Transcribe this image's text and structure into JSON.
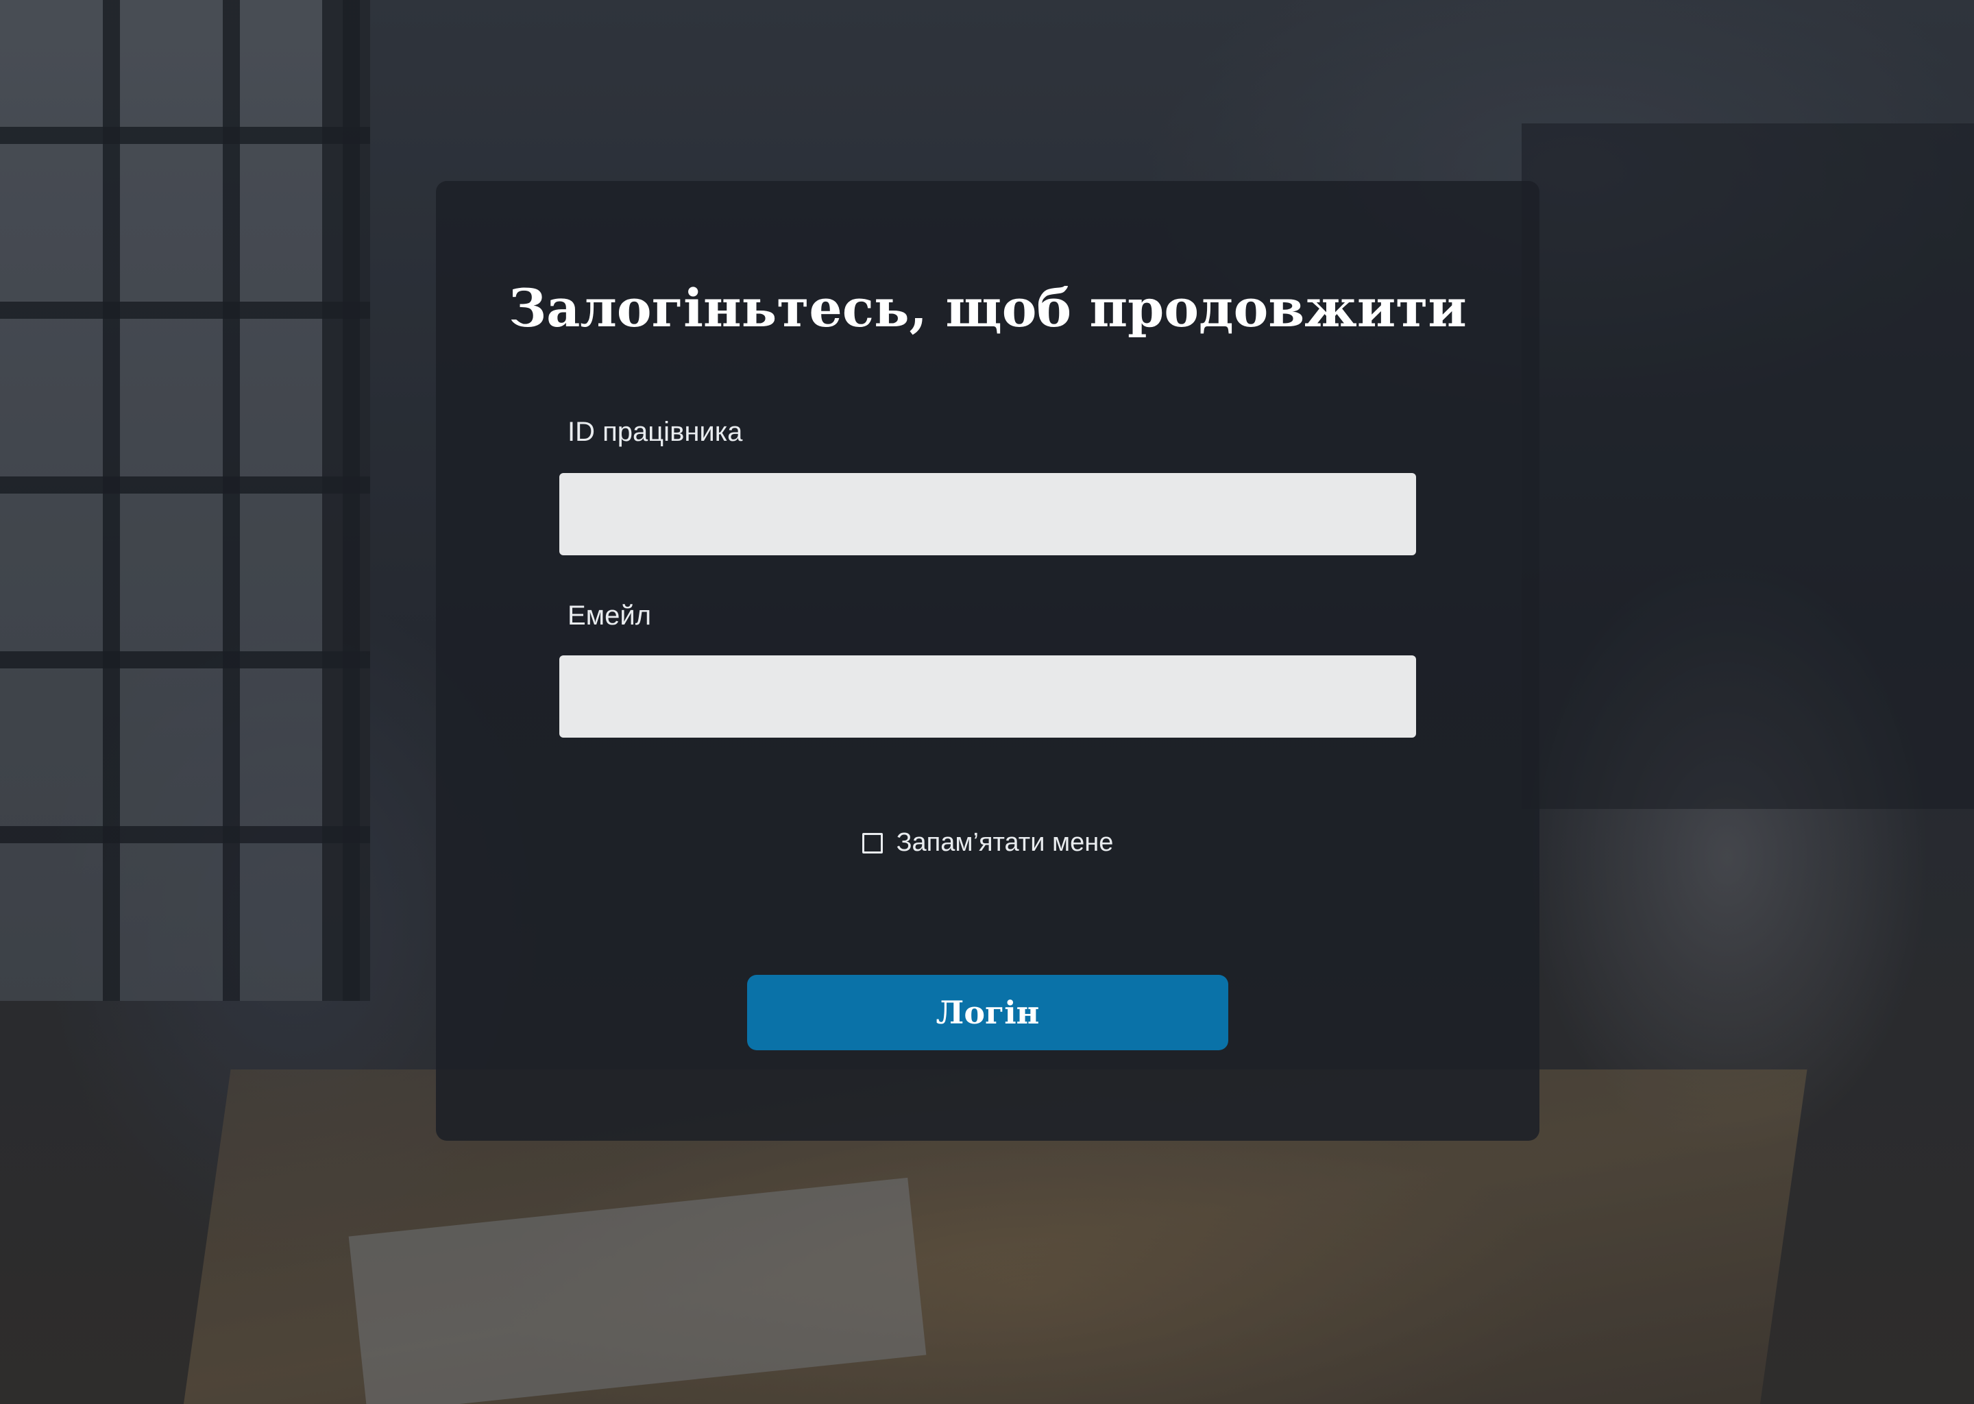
{
  "login": {
    "title": "Залогіньтесь, щоб продовжити",
    "employee_id": {
      "label": "ID працівника",
      "value": "",
      "placeholder": ""
    },
    "email": {
      "label": "Емейл",
      "value": "",
      "placeholder": ""
    },
    "remember_me": {
      "label": "Запам’ятати мене",
      "checked": false
    },
    "submit_label": "Логін"
  },
  "colors": {
    "card_background": "#1c2026",
    "input_background": "#e8e9ea",
    "button_background": "#0a72a8",
    "text": "#ffffff"
  }
}
